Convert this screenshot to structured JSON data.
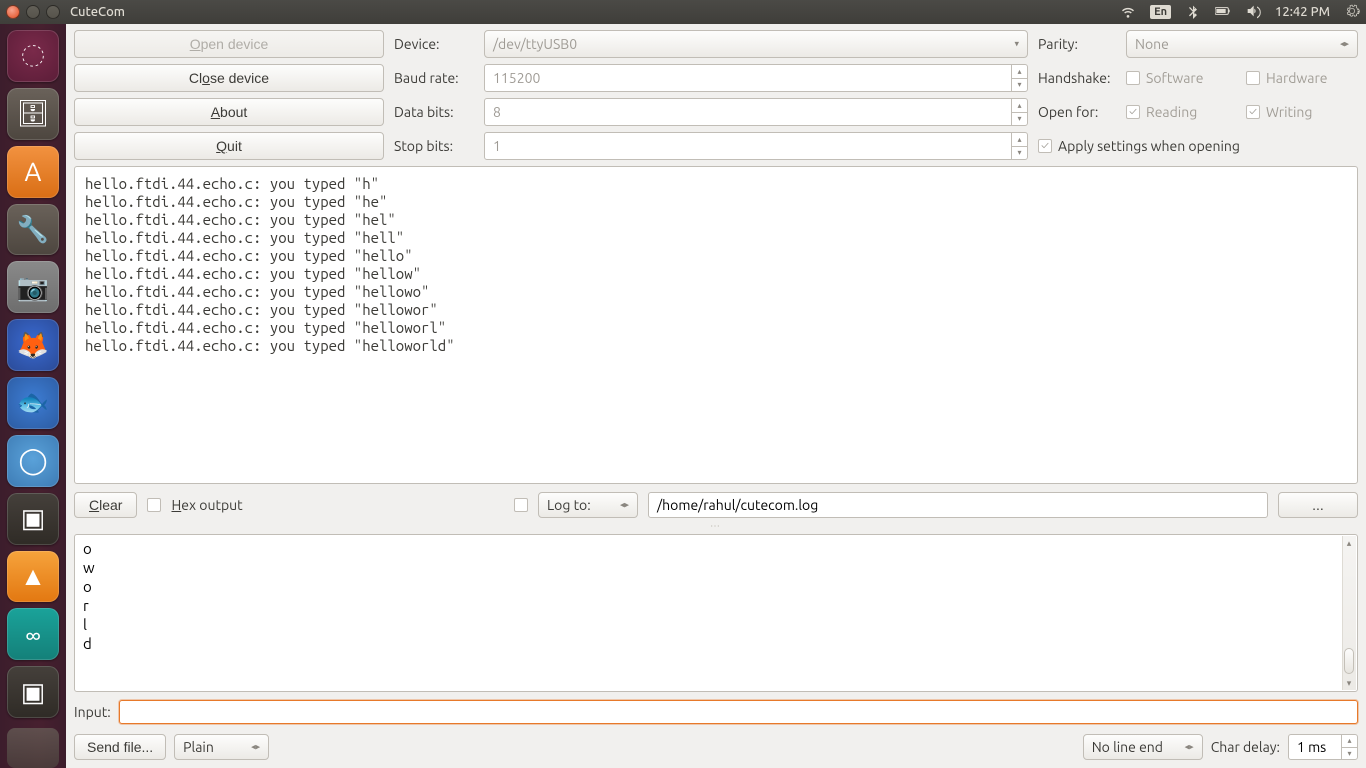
{
  "menubar": {
    "title": "CuteCom",
    "lang": "En",
    "time": "12:42 PM"
  },
  "buttons": {
    "open_device": "Open device",
    "close_device": "Close device",
    "about": "About",
    "quit": "Quit",
    "clear": "Clear",
    "browse": "...",
    "send_file": "Send file..."
  },
  "labels": {
    "device": "Device:",
    "baud": "Baud rate:",
    "data_bits": "Data bits:",
    "stop_bits": "Stop bits:",
    "parity": "Parity:",
    "handshake": "Handshake:",
    "open_for": "Open for:",
    "apply": "Apply settings when opening",
    "hex_output": "Hex output",
    "log_to": "Log to:",
    "input": "Input:",
    "char_delay": "Char delay:"
  },
  "values": {
    "device": "/dev/ttyUSB0",
    "baud": "115200",
    "data_bits": "8",
    "stop_bits": "1",
    "parity": "None",
    "log_path": "/home/rahul/cutecom.log",
    "line_end": "No line end",
    "script_mode": "Plain",
    "char_delay": "1 ms"
  },
  "checks": {
    "software": "Software",
    "hardware": "Hardware",
    "reading": "Reading",
    "writing": "Writing"
  },
  "output_lines": [
    "hello.ftdi.44.echo.c: you typed \"h\"",
    "hello.ftdi.44.echo.c: you typed \"he\"",
    "hello.ftdi.44.echo.c: you typed \"hel\"",
    "hello.ftdi.44.echo.c: you typed \"hell\"",
    "hello.ftdi.44.echo.c: you typed \"hello\"",
    "hello.ftdi.44.echo.c: you typed \"hellow\"",
    "hello.ftdi.44.echo.c: you typed \"hellowo\"",
    "hello.ftdi.44.echo.c: you typed \"hellowor\"",
    "hello.ftdi.44.echo.c: you typed \"helloworl\"",
    "hello.ftdi.44.echo.c: you typed \"helloworld\""
  ],
  "sent_lines": [
    "o",
    "w",
    "o",
    "r",
    "l",
    "d"
  ]
}
